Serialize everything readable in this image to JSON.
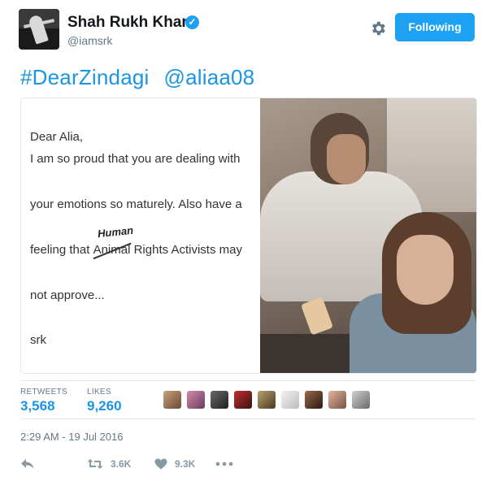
{
  "header": {
    "display_name": "Shah Rukh Khan",
    "handle": "@iamsrk",
    "follow_label": "Following"
  },
  "tweet": {
    "hashtag": "#DearZindagi",
    "mention": "@aliaa08",
    "note": {
      "line1": "Dear Alia,",
      "line2": "I am so proud that you are dealing with",
      "line3": "your emotions so maturely. Also have a",
      "line4_pre": "feeling that ",
      "line4_struck": "Animal",
      "line4_post": " Rights Activists may",
      "handwritten": "Human",
      "line5": "not approve...",
      "line6": "srk"
    }
  },
  "stats": {
    "retweets_label": "RETWEETS",
    "retweets_value": "3,568",
    "likes_label": "LIKES",
    "likes_value": "9,260"
  },
  "timestamp": "2:29 AM - 19 Jul 2016",
  "actions": {
    "retweet_count": "3.6K",
    "like_count": "9.3K"
  },
  "colors": {
    "accent": "#1da1f2",
    "link": "#1b95e0",
    "muted": "#657786"
  }
}
